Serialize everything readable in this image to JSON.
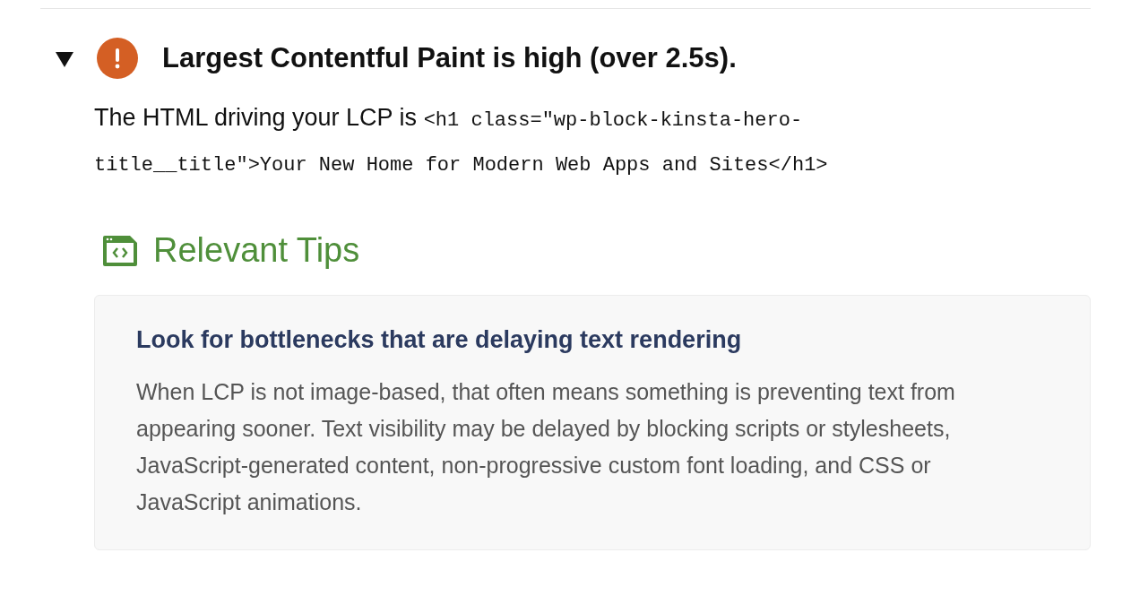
{
  "audit": {
    "expanded": true,
    "title": "Largest Contentful Paint is high (over 2.5s).",
    "description": {
      "text": "The HTML driving your LCP is ",
      "code": "<h1 class=\"wp-block-kinsta-hero-title__title\">Your New Home for Modern Web Apps and Sites</h1>"
    },
    "tips_heading": "Relevant Tips",
    "tips": [
      {
        "title": "Look for bottlenecks that are delaying text rendering",
        "body": "When LCP is not image-based, that often means something is preventing text from appearing sooner. Text visibility may be delayed by blocking scripts or stylesheets, JavaScript-generated content, non-progressive custom font loading, and CSS or JavaScript animations."
      }
    ]
  }
}
